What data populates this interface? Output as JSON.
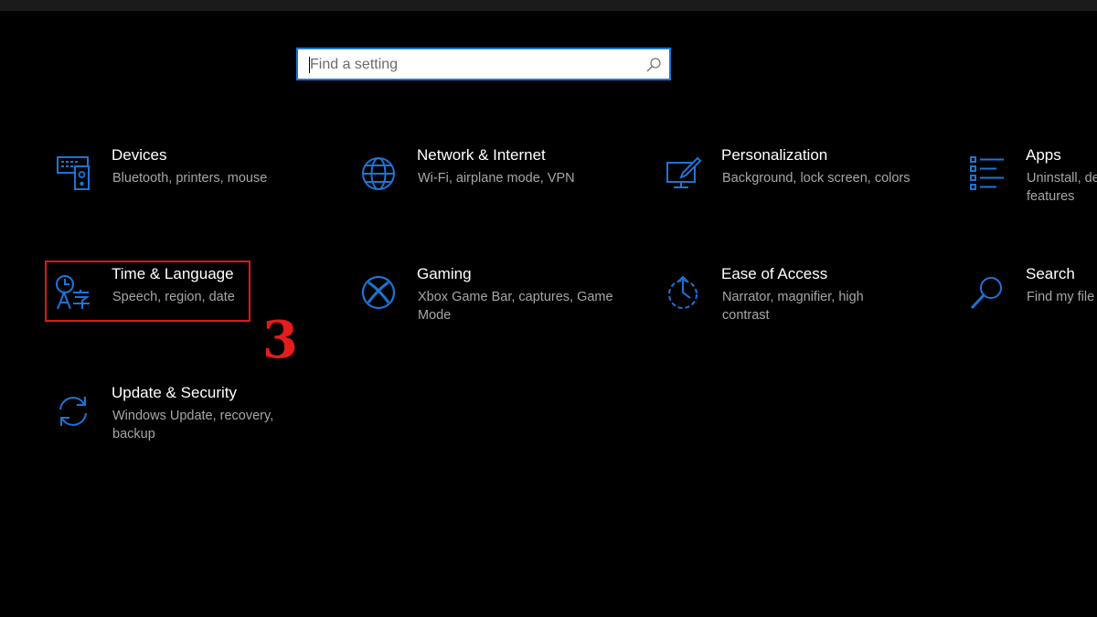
{
  "search": {
    "placeholder": "Find a setting"
  },
  "tiles": [
    {
      "title": "Devices",
      "desc": "Bluetooth, printers, mouse",
      "icon": "devices-icon"
    },
    {
      "title": "Network & Internet",
      "desc": "Wi-Fi, airplane mode, VPN",
      "icon": "globe-icon"
    },
    {
      "title": "Personalization",
      "desc": "Background, lock screen, colors",
      "icon": "personalization-icon"
    },
    {
      "title": "Apps",
      "desc": "Uninstall, de",
      "desc2": "features",
      "icon": "apps-list-icon"
    },
    {
      "title": "Time & Language",
      "desc": "Speech, region, date",
      "icon": "time-language-icon"
    },
    {
      "title": "Gaming",
      "desc": "Xbox Game Bar, captures, Game",
      "desc2": "Mode",
      "icon": "xbox-icon"
    },
    {
      "title": "Ease of Access",
      "desc": "Narrator, magnifier, high",
      "desc2": "contrast",
      "icon": "ease-of-access-icon"
    },
    {
      "title": "Search",
      "desc": "Find my file",
      "icon": "search-magnifier-icon"
    },
    {
      "title": "Update & Security",
      "desc": "Windows Update, recovery,",
      "desc2": "backup",
      "icon": "sync-arrows-icon"
    }
  ],
  "annotation": {
    "step": "3"
  },
  "colors": {
    "accent": "#1e74d6",
    "highlight": "#e01717"
  }
}
